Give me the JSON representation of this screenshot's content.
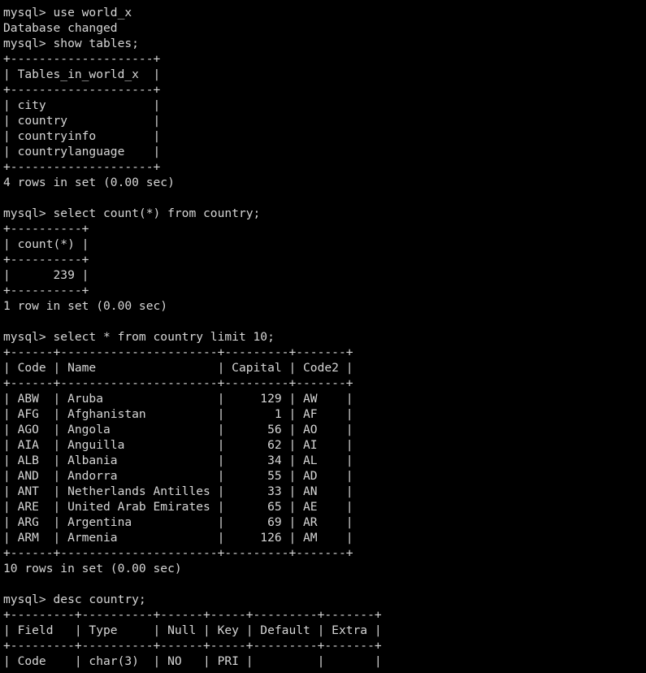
{
  "terminal": {
    "app": "mysql-client-terminal",
    "prompt": "mysql>",
    "foreground_color": "#d6d6d6",
    "background_color": "#000000",
    "lines": [
      "mysql> use world_x",
      "Database changed",
      "mysql> show tables;",
      "+--------------------+",
      "| Tables_in_world_x  |",
      "+--------------------+",
      "| city               |",
      "| country            |",
      "| countryinfo        |",
      "| countrylanguage    |",
      "+--------------------+",
      "4 rows in set (0.00 sec)",
      "",
      "mysql> select count(*) from country;",
      "+----------+",
      "| count(*) |",
      "+----------+",
      "|      239 |",
      "+----------+",
      "1 row in set (0.00 sec)",
      "",
      "mysql> select * from country limit 10;",
      "+------+----------------------+---------+-------+",
      "| Code | Name                 | Capital | Code2 |",
      "+------+----------------------+---------+-------+",
      "| ABW  | Aruba                |     129 | AW    |",
      "| AFG  | Afghanistan          |       1 | AF    |",
      "| AGO  | Angola               |      56 | AO    |",
      "| AIA  | Anguilla             |      62 | AI    |",
      "| ALB  | Albania              |      34 | AL    |",
      "| AND  | Andorra              |      55 | AD    |",
      "| ANT  | Netherlands Antilles |      33 | AN    |",
      "| ARE  | United Arab Emirates |      65 | AE    |",
      "| ARG  | Argentina            |      69 | AR    |",
      "| ARM  | Armenia              |     126 | AM    |",
      "+------+----------------------+---------+-------+",
      "10 rows in set (0.00 sec)",
      "",
      "mysql> desc country;",
      "+---------+----------+------+-----+---------+-------+",
      "| Field   | Type     | Null | Key | Default | Extra |",
      "+---------+----------+------+-----+---------+-------+",
      "| Code    | char(3)  | NO   | PRI |         |       |"
    ],
    "commands": [
      {
        "name": "use-database",
        "text": "use world_x",
        "response": "Database changed"
      },
      {
        "name": "show-tables",
        "text": "show tables;",
        "row_count": "4 rows in set (0.00 sec)"
      },
      {
        "name": "select-count",
        "text": "select count(*) from country;",
        "row_count": "1 row in set (0.00 sec)"
      },
      {
        "name": "select-country-limit",
        "text": "select * from country limit 10;",
        "row_count": "10 rows in set (0.00 sec)"
      },
      {
        "name": "desc-country",
        "text": "desc country;",
        "row_count": ""
      }
    ],
    "tables": {
      "show_tables": {
        "columns": [
          "Tables_in_world_x"
        ],
        "rows": [
          [
            "city"
          ],
          [
            "country"
          ],
          [
            "countryinfo"
          ],
          [
            "countrylanguage"
          ]
        ]
      },
      "count_country": {
        "columns": [
          "count(*)"
        ],
        "rows": [
          [
            "239"
          ]
        ]
      },
      "country_sample": {
        "columns": [
          "Code",
          "Name",
          "Capital",
          "Code2"
        ],
        "rows": [
          [
            "ABW",
            "Aruba",
            "129",
            "AW"
          ],
          [
            "AFG",
            "Afghanistan",
            "1",
            "AF"
          ],
          [
            "AGO",
            "Angola",
            "56",
            "AO"
          ],
          [
            "AIA",
            "Anguilla",
            "62",
            "AI"
          ],
          [
            "ALB",
            "Albania",
            "34",
            "AL"
          ],
          [
            "AND",
            "Andorra",
            "55",
            "AD"
          ],
          [
            "ANT",
            "Netherlands Antilles",
            "33",
            "AN"
          ],
          [
            "ARE",
            "United Arab Emirates",
            "65",
            "AE"
          ],
          [
            "ARG",
            "Argentina",
            "69",
            "AR"
          ],
          [
            "ARM",
            "Armenia",
            "126",
            "AM"
          ]
        ]
      },
      "desc_country": {
        "columns": [
          "Field",
          "Type",
          "Null",
          "Key",
          "Default",
          "Extra"
        ],
        "rows": [
          [
            "Code",
            "char(3)",
            "NO",
            "PRI",
            "",
            ""
          ]
        ]
      }
    }
  }
}
